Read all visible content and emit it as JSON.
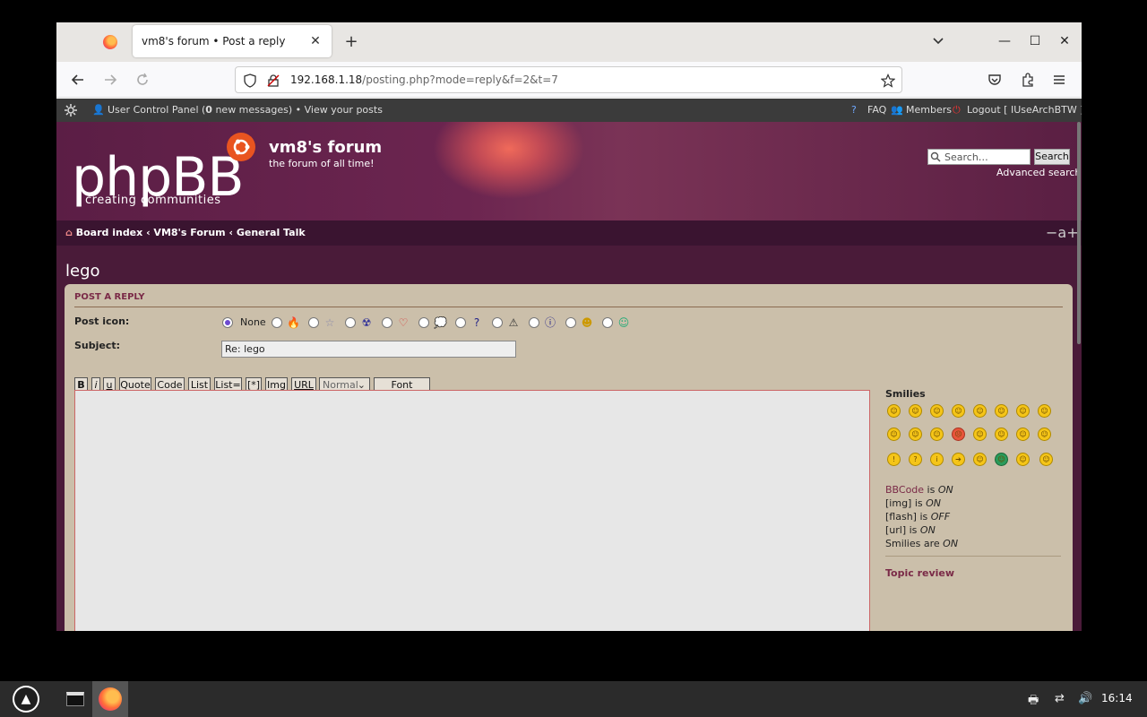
{
  "browser": {
    "tab_title": "vm8's forum • Post a reply",
    "tab_close": "✕",
    "new_tab": "+",
    "url_host": "192.168.1.18",
    "url_path": "/posting.php?mode=reply&f=2&t=7",
    "minimize": "—",
    "maximize": "☐",
    "close": "✕"
  },
  "forum": {
    "topbar": {
      "ucp": "User Control Panel (",
      "ucp_count": "0",
      "ucp_rest": " new messages) • View your posts",
      "faq": "FAQ",
      "members": "Members",
      "logout": "Logout [ IUseArchBTW ]"
    },
    "logo_text": "phpBB",
    "logo_sub": "creating communities",
    "site_title": "vm8's forum",
    "site_desc": "the forum of all time!",
    "search_placeholder": "Search…",
    "search_button": "Search",
    "advanced_search": "Advanced search",
    "breadcrumbs": "Board index ‹ VM8's Forum ‹ General Talk",
    "font_resize": "−a+",
    "topic_title": "lego"
  },
  "form": {
    "heading": "POST A REPLY",
    "post_icon_label": "Post icon:",
    "none_label": "None",
    "subject_label": "Subject:",
    "subject_value": "Re: lego",
    "bbcode_buttons": [
      "B",
      "i",
      "u",
      "Quote",
      "Code",
      "List",
      "List=",
      "[*]",
      "Img",
      "URL"
    ],
    "font_size_select": "Normal",
    "font_colour": "Font colour",
    "smilies_heading": "Smilies",
    "status": {
      "bbcode_link": "BBCode",
      "bbcode": " is ",
      "bbcode_state": "ON",
      "img": "[img] is ",
      "img_state": "ON",
      "flash": "[flash] is ",
      "flash_state": "OFF",
      "url": "[url] is ",
      "url_state": "ON",
      "smilies": "Smilies are ",
      "smilies_state": "ON"
    },
    "topic_review": "Topic review"
  },
  "taskbar": {
    "clock": "16:14"
  }
}
